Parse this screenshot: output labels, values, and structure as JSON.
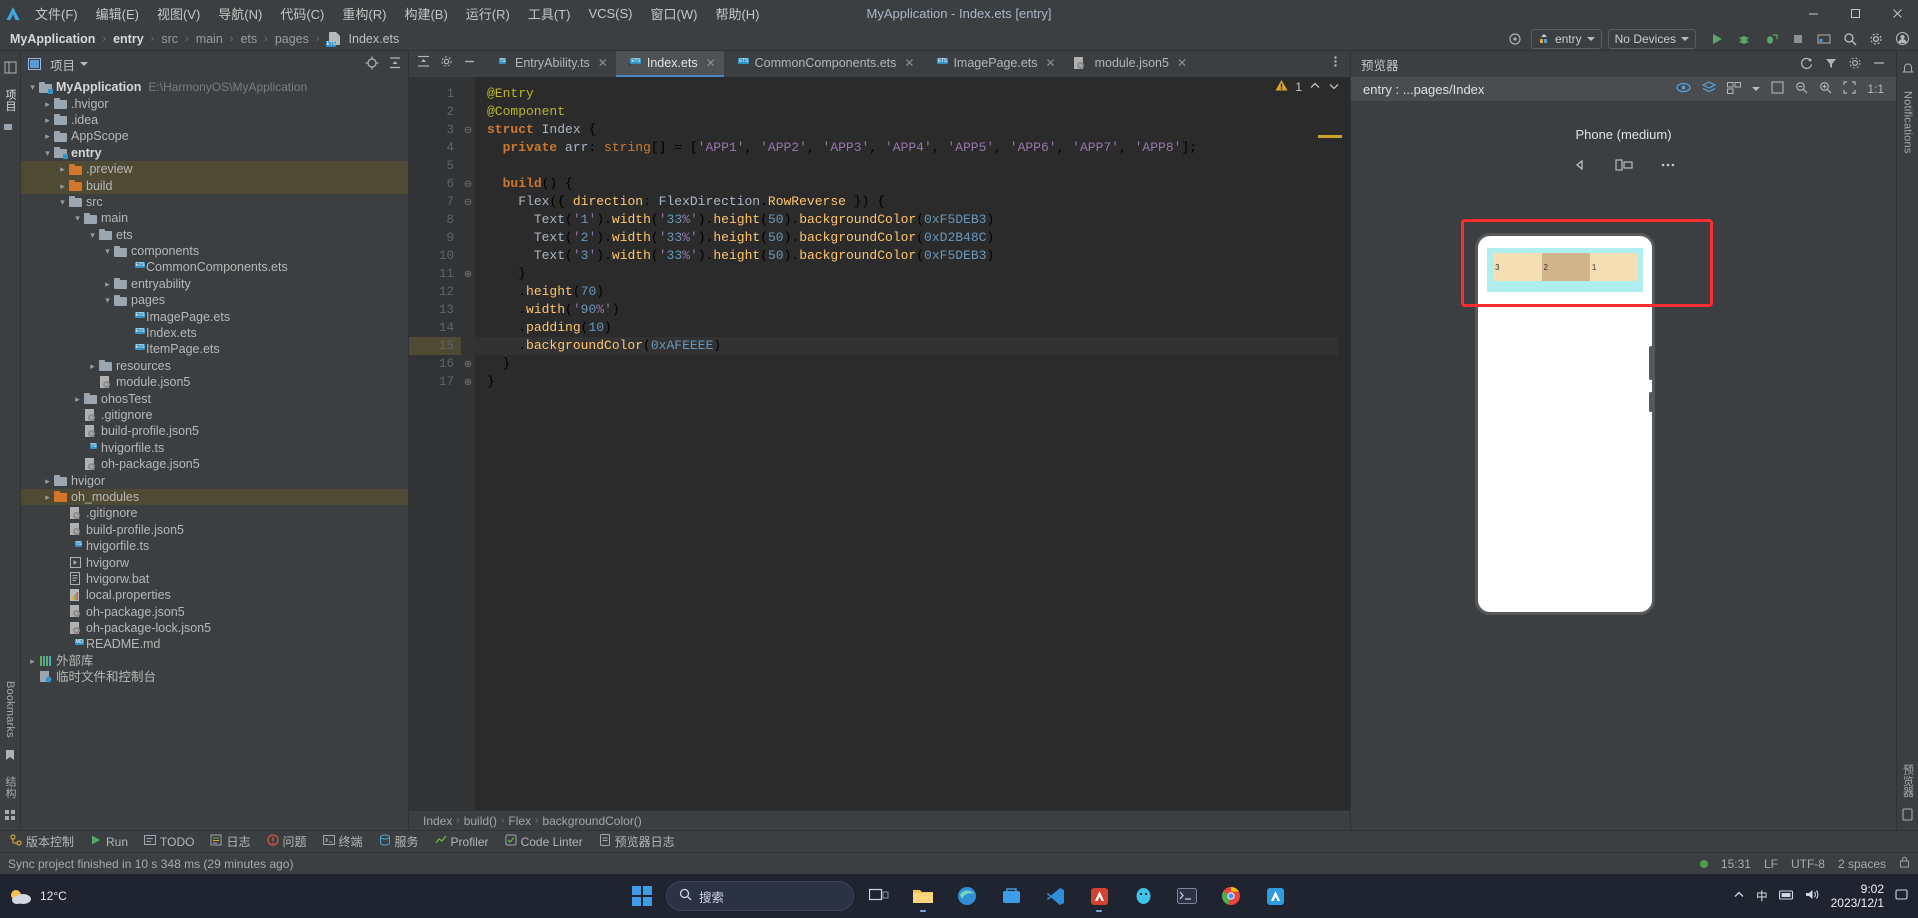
{
  "window": {
    "title": "MyApplication - Index.ets [entry]",
    "minimize": "─",
    "restore": "❐",
    "close": "✕"
  },
  "menu": {
    "items": [
      {
        "label": "文件(F)",
        "name": "menu-file"
      },
      {
        "label": "编辑(E)",
        "name": "menu-edit"
      },
      {
        "label": "视图(V)",
        "name": "menu-view"
      },
      {
        "label": "导航(N)",
        "name": "menu-navigate"
      },
      {
        "label": "代码(C)",
        "name": "menu-code"
      },
      {
        "label": "重构(R)",
        "name": "menu-refactor"
      },
      {
        "label": "构建(B)",
        "name": "menu-build"
      },
      {
        "label": "运行(R)",
        "name": "menu-run"
      },
      {
        "label": "工具(T)",
        "name": "menu-tools"
      },
      {
        "label": "VCS(S)",
        "name": "menu-vcs"
      },
      {
        "label": "窗口(W)",
        "name": "menu-window"
      },
      {
        "label": "帮助(H)",
        "name": "menu-help"
      }
    ]
  },
  "breadcrumb": {
    "items": [
      "MyApplication",
      "entry",
      "src",
      "main",
      "ets",
      "pages"
    ],
    "file": "Index.ets",
    "separator": "›"
  },
  "toolbar": {
    "run_config": "entry",
    "device": "No Devices",
    "run_tooltip": "Run",
    "debug_tooltip": "Debug",
    "profile_tooltip": "Profile",
    "stop_tooltip": "Stop",
    "search_tooltip": "Search",
    "settings_tooltip": "Settings",
    "account_tooltip": "Account"
  },
  "left_strip": {
    "items": [
      "项目",
      "结构",
      "Bookmarks"
    ]
  },
  "project_panel": {
    "title": "项目",
    "locate_tooltip": "Select Opened File",
    "collapse_tooltip": "Collapse All",
    "settings_tooltip": "Options",
    "hide_tooltip": "Hide",
    "tree": [
      {
        "label": "MyApplication",
        "sub": "E:\\HarmonyOS\\MyApplication",
        "indent": 0,
        "arrow": "down",
        "icon": "module",
        "bold": true
      },
      {
        "label": ".hvigor",
        "indent": 1,
        "arrow": "right",
        "icon": "folder"
      },
      {
        "label": ".idea",
        "indent": 1,
        "arrow": "right",
        "icon": "folder"
      },
      {
        "label": "AppScope",
        "indent": 1,
        "arrow": "right",
        "icon": "folder"
      },
      {
        "label": "entry",
        "indent": 1,
        "arrow": "down",
        "icon": "module",
        "bold": true
      },
      {
        "label": ".preview",
        "indent": 2,
        "arrow": "right",
        "icon": "folder-orange",
        "highlight": true
      },
      {
        "label": "build",
        "indent": 2,
        "arrow": "right",
        "icon": "folder-orange",
        "highlight": true
      },
      {
        "label": "src",
        "indent": 2,
        "arrow": "down",
        "icon": "folder"
      },
      {
        "label": "main",
        "indent": 3,
        "arrow": "down",
        "icon": "folder"
      },
      {
        "label": "ets",
        "indent": 4,
        "arrow": "down",
        "icon": "folder"
      },
      {
        "label": "components",
        "indent": 5,
        "arrow": "down",
        "icon": "folder"
      },
      {
        "label": "CommonComponents.ets",
        "indent": 6,
        "arrow": "none",
        "icon": "file-ets"
      },
      {
        "label": "entryability",
        "indent": 5,
        "arrow": "right",
        "icon": "folder"
      },
      {
        "label": "pages",
        "indent": 5,
        "arrow": "down",
        "icon": "folder"
      },
      {
        "label": "ImagePage.ets",
        "indent": 6,
        "arrow": "none",
        "icon": "file-ets"
      },
      {
        "label": "Index.ets",
        "indent": 6,
        "arrow": "none",
        "icon": "file-ets"
      },
      {
        "label": "ItemPage.ets",
        "indent": 6,
        "arrow": "none",
        "icon": "file-ets"
      },
      {
        "label": "resources",
        "indent": 4,
        "arrow": "right",
        "icon": "folder"
      },
      {
        "label": "module.json5",
        "indent": 4,
        "arrow": "none",
        "icon": "file-json5"
      },
      {
        "label": "ohosTest",
        "indent": 3,
        "arrow": "right",
        "icon": "folder"
      },
      {
        "label": ".gitignore",
        "indent": 3,
        "arrow": "none",
        "icon": "file-json5"
      },
      {
        "label": "build-profile.json5",
        "indent": 3,
        "arrow": "none",
        "icon": "file-json5"
      },
      {
        "label": "hvigorfile.ts",
        "indent": 3,
        "arrow": "none",
        "icon": "file-ts"
      },
      {
        "label": "oh-package.json5",
        "indent": 3,
        "arrow": "none",
        "icon": "file-json5"
      },
      {
        "label": "hvigor",
        "indent": 1,
        "arrow": "right",
        "icon": "folder"
      },
      {
        "label": "oh_modules",
        "indent": 1,
        "arrow": "right",
        "icon": "folder-orange",
        "highlight": true
      },
      {
        "label": ".gitignore",
        "indent": 2,
        "arrow": "none",
        "icon": "file-json5"
      },
      {
        "label": "build-profile.json5",
        "indent": 2,
        "arrow": "none",
        "icon": "file-json5"
      },
      {
        "label": "hvigorfile.ts",
        "indent": 2,
        "arrow": "none",
        "icon": "file-ts"
      },
      {
        "label": "hvigorw",
        "indent": 2,
        "arrow": "none",
        "icon": "file-script"
      },
      {
        "label": "hvigorw.bat",
        "indent": 2,
        "arrow": "none",
        "icon": "file-bat"
      },
      {
        "label": "local.properties",
        "indent": 2,
        "arrow": "none",
        "icon": "file-props"
      },
      {
        "label": "oh-package.json5",
        "indent": 2,
        "arrow": "none",
        "icon": "file-json5"
      },
      {
        "label": "oh-package-lock.json5",
        "indent": 2,
        "arrow": "none",
        "icon": "file-json5"
      },
      {
        "label": "README.md",
        "indent": 2,
        "arrow": "none",
        "icon": "file-md"
      },
      {
        "label": "外部库",
        "indent": 0,
        "arrow": "right",
        "icon": "library"
      },
      {
        "label": "临时文件和控制台",
        "indent": 0,
        "arrow": "none",
        "icon": "scratch"
      }
    ]
  },
  "editor": {
    "tabs": [
      {
        "label": "EntryAbility.ts",
        "icon": "ts",
        "active": false
      },
      {
        "label": "Index.ets",
        "icon": "ets",
        "active": true
      },
      {
        "label": "CommonComponents.ets",
        "icon": "ets",
        "active": false
      },
      {
        "label": "ImagePage.ets",
        "icon": "ets",
        "active": false
      },
      {
        "label": "module.json5",
        "icon": "json5",
        "active": false
      }
    ],
    "warning_count": "1",
    "prev_tooltip": "Previous Highlighted Error",
    "next_tooltip": "Next Highlighted Error",
    "more_tooltip": "More",
    "line_numbers": [
      "1",
      "2",
      "3",
      "4",
      "5",
      "6",
      "7",
      "8",
      "9",
      "10",
      "11",
      "12",
      "13",
      "14",
      "15",
      "16",
      "17"
    ],
    "code_lines": [
      "@Entry",
      "@Component",
      "struct Index {",
      "  private arr: string[] = ['APP1', 'APP2', 'APP3', 'APP4', 'APP5', 'APP6', 'APP7', 'APP8'];",
      "",
      "  build() {",
      "    Flex({ direction: FlexDirection.RowReverse }) {",
      "      Text('1').width('33%').height(50).backgroundColor(0xF5DEB3)",
      "      Text('2').width('33%').height(50).backgroundColor(0xD2B48C)",
      "      Text('3').width('33%').height(50).backgroundColor(0xF5DEB3)",
      "    }",
      "    .height(70)",
      "    .width('90%')",
      "    .padding(10)",
      "    .backgroundColor(0xAFEEEE)",
      "  }",
      "}"
    ],
    "status_crumb": [
      "Index",
      "build()",
      "Flex",
      "backgroundColor()"
    ],
    "crumb_separator": "›"
  },
  "preview": {
    "title": "预览器",
    "path": "entry : ...pages/Index",
    "device_name": "Phone (medium)",
    "rotate_tooltip": "Rotate",
    "multi_tooltip": "Multi-device Preview",
    "more_tooltip": "More",
    "inspector_tooltip": "Inspector",
    "layers_tooltip": "Layers",
    "grid_tooltip": "Grid",
    "zoom_reset": "1:1",
    "phone_cells": [
      "1",
      "2",
      "3"
    ],
    "colors": {
      "cell1": "#F5DEB3",
      "cell2": "#D2B48C",
      "cell3": "#F5DEB3",
      "container": "#AFEEEE",
      "highlight_box": "#FF2D2D"
    }
  },
  "right_strip": {
    "items": [
      "Notifications",
      "预览器"
    ]
  },
  "bottom_toolwindows": [
    {
      "label": "版本控制",
      "icon": "vcs-icon"
    },
    {
      "label": "Run",
      "icon": "run-icon"
    },
    {
      "label": "TODO",
      "icon": "todo-icon"
    },
    {
      "label": "日志",
      "icon": "log-icon"
    },
    {
      "label": "问题",
      "icon": "problems-icon"
    },
    {
      "label": "终端",
      "icon": "terminal-icon"
    },
    {
      "label": "服务",
      "icon": "services-icon"
    },
    {
      "label": "Profiler",
      "icon": "profiler-icon"
    },
    {
      "label": "Code Linter",
      "icon": "linter-icon"
    },
    {
      "label": "预览器日志",
      "icon": "previewlog-icon"
    }
  ],
  "statusbar": {
    "message": "Sync project finished in 10 s 348 ms (29 minutes ago)",
    "time": "15:31",
    "line_sep": "LF",
    "encoding": "UTF-8",
    "indent": "2 spaces"
  },
  "taskbar": {
    "weather_temp": "12°C",
    "search_placeholder": "搜索",
    "clock_time": "9:02",
    "clock_date": "2023/12/1",
    "ime": "中",
    "apps": [
      {
        "name": "file-explorer-icon"
      },
      {
        "name": "folder-icon"
      },
      {
        "name": "edge-icon"
      },
      {
        "name": "store-icon"
      },
      {
        "name": "vscode-icon"
      },
      {
        "name": "deveco-icon"
      },
      {
        "name": "qq-icon"
      },
      {
        "name": "terminal-icon"
      },
      {
        "name": "chrome-icon"
      },
      {
        "name": "harmony-icon"
      }
    ]
  }
}
